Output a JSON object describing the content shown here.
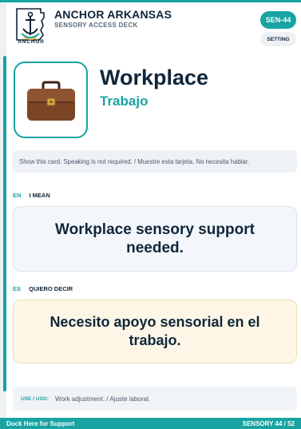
{
  "header": {
    "brand_name": "ANCHOR ARKANSAS",
    "brand_subtitle": "SENSORY ACCESS DECK",
    "logo_word": "ANCHOR",
    "card_code": "SEN-44",
    "setting_label": "SETTING"
  },
  "card": {
    "icon": "briefcase-icon",
    "title": "Workplace",
    "subtitle": "Trabajo",
    "instruction": "Show this card. Speaking is not required. / Muestre esta tarjeta. No necesita hablar."
  },
  "english": {
    "code": "EN",
    "label": "I MEAN",
    "phrase": "Workplace sensory support needed."
  },
  "spanish": {
    "code": "ES",
    "label": "QUIERO DECIR",
    "phrase": "Necesito apoyo sensorial en el trabajo."
  },
  "use": {
    "label": "USE / USO:",
    "text": "Work adjustment. / Ajuste laboral."
  },
  "footer": {
    "left": "Dock Here for Support",
    "right": "SENSORY 44 / 52"
  },
  "colors": {
    "accent": "#19a3a3",
    "navy": "#10263a",
    "english_bg": "#f3f7fb",
    "spanish_bg": "#fdf6e6"
  }
}
